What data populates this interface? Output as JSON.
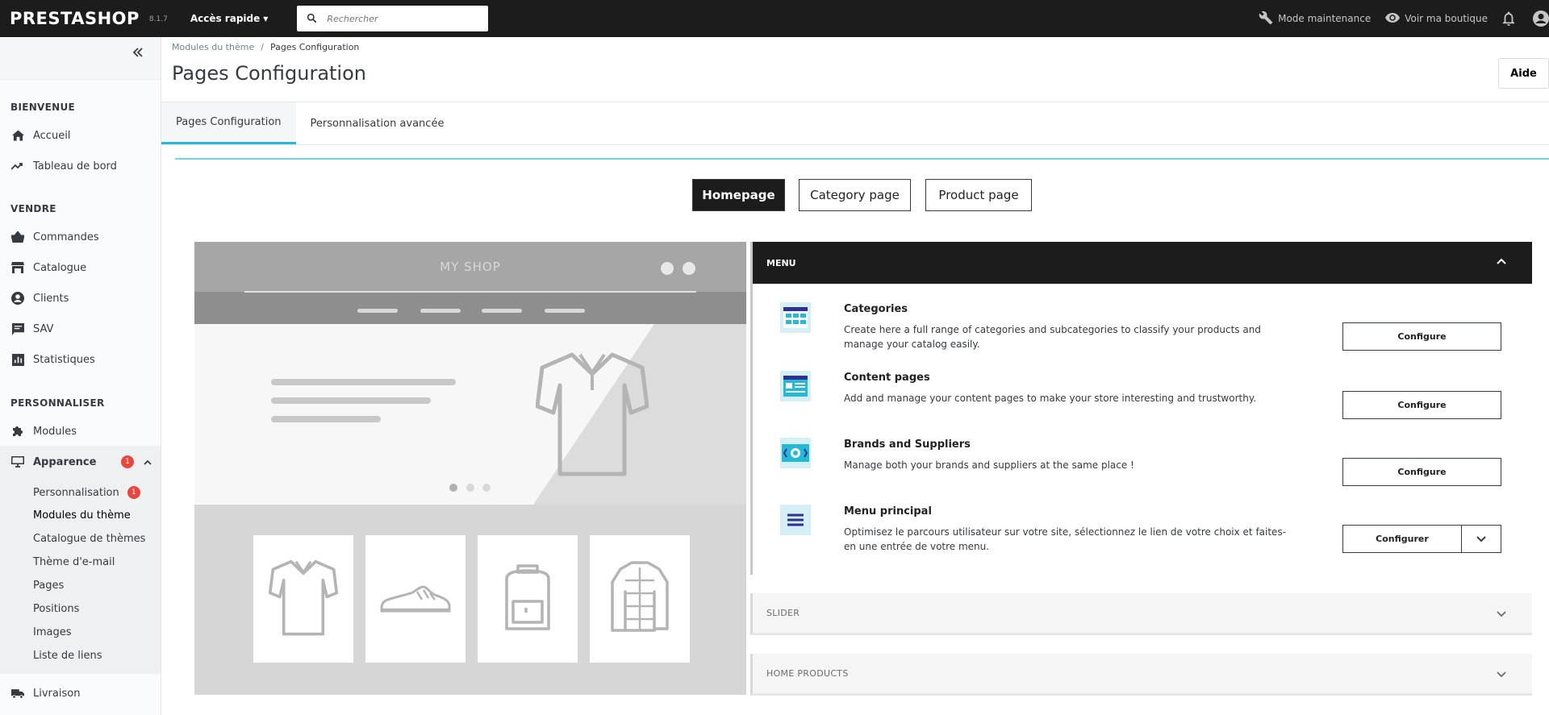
{
  "topbar": {
    "logo": "PRESTASHOP",
    "version": "8.1.7",
    "quick_access": "Accès rapide",
    "search_placeholder": "Rechercher",
    "maintenance": "Mode maintenance",
    "view_shop": "Voir ma boutique"
  },
  "sidebar": {
    "sections": {
      "welcome": "BIENVENUE",
      "sell": "VENDRE",
      "customize": "PERSONNALISER"
    },
    "items": {
      "home": "Accueil",
      "dashboard": "Tableau de bord",
      "orders": "Commandes",
      "catalog": "Catalogue",
      "customers": "Clients",
      "sav": "SAV",
      "stats": "Statistiques",
      "modules": "Modules",
      "appearance": "Apparence",
      "appearance_badge": "1",
      "shipping": "Livraison"
    },
    "sub_items": {
      "personalization": "Personnalisation",
      "personalization_badge": "1",
      "theme_modules": "Modules du thème",
      "theme_catalog": "Catalogue de thèmes",
      "email_theme": "Thème d'e-mail",
      "pages": "Pages",
      "positions": "Positions",
      "images": "Images",
      "link_list": "Liste de liens"
    }
  },
  "header": {
    "breadcrumb_parent": "Modules du thème",
    "breadcrumb_sep": "/",
    "breadcrumb_current": "Pages Configuration",
    "title": "Pages Configuration",
    "help": "Aide"
  },
  "tabs": {
    "pages_config": "Pages Configuration",
    "advanced": "Personnalisation avancée"
  },
  "page_types": {
    "homepage": "Homepage",
    "category": "Category page",
    "product": "Product page"
  },
  "preview": {
    "shop_name": "MY SHOP"
  },
  "menu_panel": {
    "title": "MENU",
    "modules": [
      {
        "title": "Categories",
        "desc": "Create here a full range of categories and subcategories to classify your products and manage your catalog easily.",
        "button": "Configure"
      },
      {
        "title": "Content pages",
        "desc": "Add and manage your content pages to make your store interesting and trustworthy.",
        "button": "Configure"
      },
      {
        "title": "Brands and Suppliers",
        "desc": "Manage both your brands and suppliers at the same place !",
        "button": "Configure"
      },
      {
        "title": "Menu principal",
        "desc": "Optimisez le parcours utilisateur sur votre site, sélectionnez le lien de votre choix et faites-en une entrée de votre menu.",
        "button": "Configurer"
      }
    ]
  },
  "accordions": {
    "slider": "SLIDER",
    "home_products": "HOME PRODUCTS"
  },
  "colors": {
    "accent": "#25b9d7",
    "badge": "#e8463e",
    "dark": "#1c1c1c"
  }
}
